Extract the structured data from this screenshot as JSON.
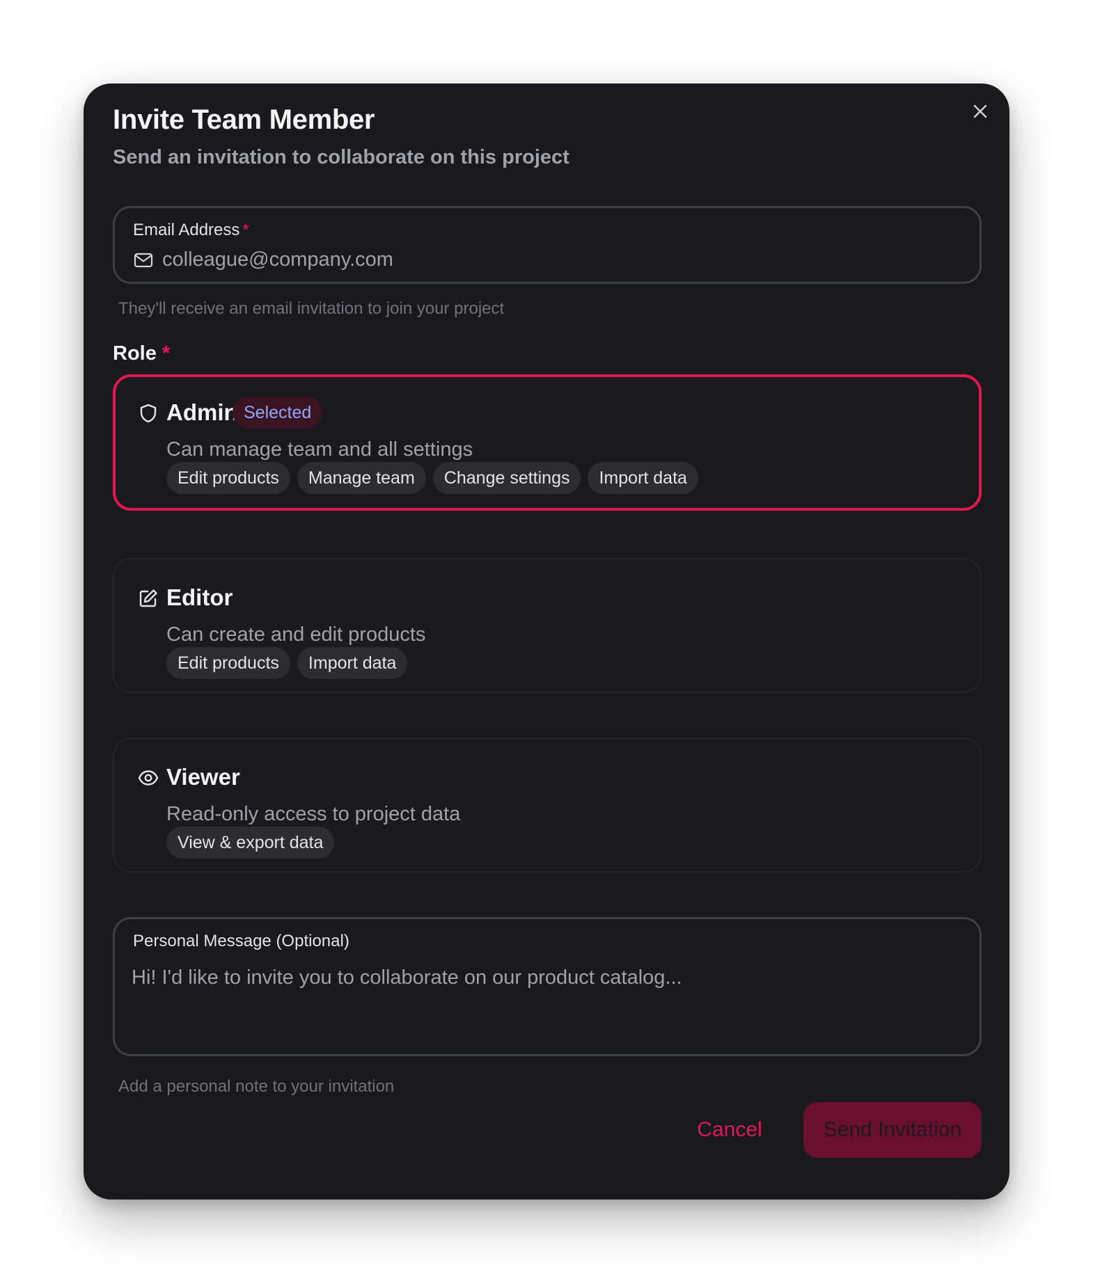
{
  "dialog": {
    "title": "Invite Team Member",
    "subtitle": "Send an invitation to collaborate on this project",
    "close_icon": "close-icon"
  },
  "email": {
    "label": "Email Address",
    "required_marker": "*",
    "icon": "mail-icon",
    "value": "",
    "placeholder": "colleague@company.com",
    "helper": "They'll receive an email invitation to join your project"
  },
  "role": {
    "label": "Role",
    "required_marker": "*",
    "selected": "admin",
    "options": [
      {
        "id": "admin",
        "icon": "shield-icon",
        "name": "Admin",
        "badge": "Selected",
        "description": "Can manage team and all settings",
        "permissions": [
          "Edit products",
          "Manage team",
          "Change settings",
          "Import data"
        ]
      },
      {
        "id": "editor",
        "icon": "edit-icon",
        "name": "Editor",
        "description": "Can create and edit products",
        "permissions": [
          "Edit products",
          "Import data"
        ]
      },
      {
        "id": "viewer",
        "icon": "eye-icon",
        "name": "Viewer",
        "description": "Read-only access to project data",
        "permissions": [
          "View & export data"
        ]
      }
    ]
  },
  "message": {
    "label": "Personal Message (Optional)",
    "value": "",
    "placeholder": "Hi! I'd like to invite you to collaborate on our product catalog...",
    "helper": "Add a personal note to your invitation"
  },
  "actions": {
    "cancel_label": "Cancel",
    "send_label": "Send Invitation"
  },
  "colors": {
    "accent": "#e0184f",
    "badge_text": "#8fa8ff",
    "send_button_bg": "#6b0f2e",
    "modal_bg": "#1a1a1d"
  }
}
